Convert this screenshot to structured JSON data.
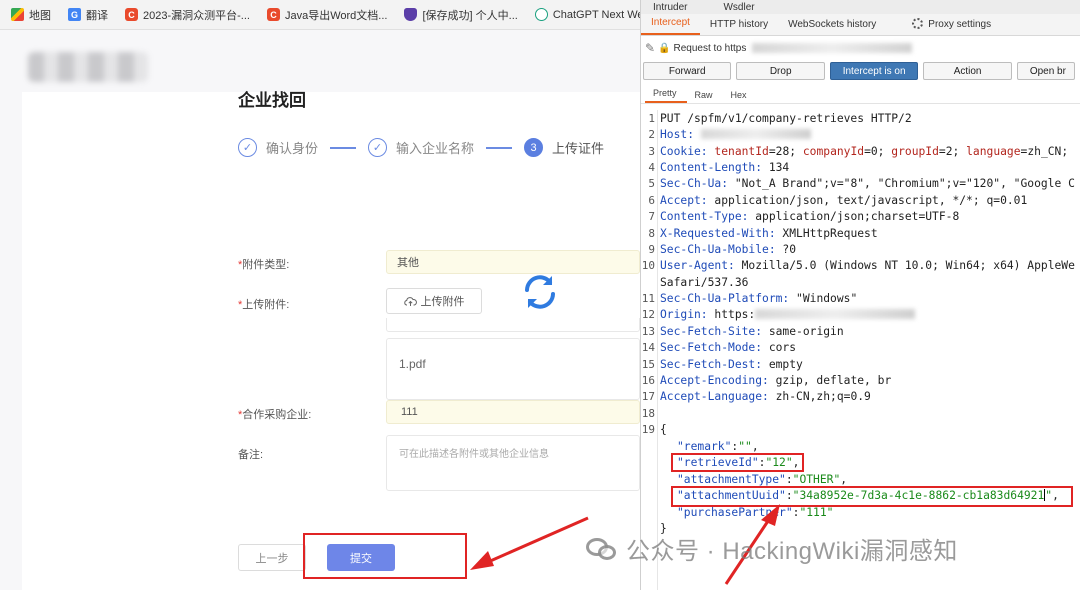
{
  "bookmarks": [
    {
      "label": "地图",
      "icon": "map-icon"
    },
    {
      "label": "翻译",
      "icon": "translate-icon"
    },
    {
      "label": "2023-漏洞众测平台-...",
      "icon": "csdn-icon"
    },
    {
      "label": "Java导出Word文档...",
      "icon": "csdn-icon"
    },
    {
      "label": "[保存成功] 个人中...",
      "icon": "shield-icon"
    },
    {
      "label": "ChatGPT Next Web",
      "icon": "chatgpt-icon"
    }
  ],
  "app": {
    "title": "企业找回",
    "steps": [
      {
        "label": "确认身份",
        "state": "done"
      },
      {
        "label": "输入企业名称",
        "state": "done"
      },
      {
        "number": "3",
        "label": "上传证件",
        "state": "active"
      }
    ],
    "form": {
      "attachment_type": {
        "label": "附件类型:",
        "value": "其他"
      },
      "upload": {
        "label": "上传附件:",
        "button": "上传附件",
        "file": "1.pdf"
      },
      "partner": {
        "label": "合作采购企业:",
        "value": "111"
      },
      "remark": {
        "label": "备注:",
        "placeholder": "可在此描述各附件或其他企业信息"
      }
    },
    "buttons": {
      "prev": "上一步",
      "submit": "提交"
    }
  },
  "burp": {
    "top_tabs": [
      "Intruder",
      "Wsdler"
    ],
    "tabs": [
      "Intercept",
      "HTTP history",
      "WebSockets history",
      "Proxy settings"
    ],
    "request_label": "Request to https",
    "buttons": [
      "Forward",
      "Drop",
      "Intercept is on",
      "Action",
      "Open br"
    ],
    "sub_tabs": [
      "Pretty",
      "Raw",
      "Hex"
    ],
    "lines": {
      "l1": "PUT /spfm/v1/company-retrieves HTTP/2",
      "host_k": "Host:",
      "cookie_k": "Cookie:",
      "cookie_parts": {
        "k1": "tenantId",
        "v1": "=28; ",
        "k2": "companyId",
        "v2": "=0; ",
        "k3": "groupId",
        "v3": "=2; ",
        "k4": "language",
        "v4": "=zh_CN;"
      },
      "h4": {
        "k": "Content-Length:",
        "v": " 134"
      },
      "h5": {
        "k": "Sec-Ch-Ua:",
        "v": " \"Not_A Brand\";v=\"8\", \"Chromium\";v=\"120\", \"Google C"
      },
      "h6": {
        "k": "Accept:",
        "v": " application/json, text/javascript, */*; q=0.01"
      },
      "h7": {
        "k": "Content-Type:",
        "v": " application/json;charset=UTF-8"
      },
      "h8": {
        "k": "X-Requested-With:",
        "v": " XMLHttpRequest"
      },
      "h9": {
        "k": "Sec-Ch-Ua-Mobile:",
        "v": " ?0"
      },
      "h10": {
        "k": "User-Agent:",
        "v": " Mozilla/5.0 (Windows NT 10.0; Win64; x64) AppleWe"
      },
      "h10b": "Safari/537.36",
      "h11": {
        "k": "Sec-Ch-Ua-Platform:",
        "v": " \"Windows\""
      },
      "h12": {
        "k": "Origin:",
        "v": " https:"
      },
      "h13": {
        "k": "Sec-Fetch-Site:",
        "v": " same-origin"
      },
      "h14": {
        "k": "Sec-Fetch-Mode:",
        "v": " cors"
      },
      "h15": {
        "k": "Sec-Fetch-Dest:",
        "v": " empty"
      },
      "h16": {
        "k": "Accept-Encoding:",
        "v": " gzip, deflate, br"
      },
      "h17": {
        "k": "Accept-Language:",
        "v": " zh-CN,zh;q=0.9"
      },
      "open": "{",
      "close": "}",
      "json": {
        "remark_k": "\"remark\"",
        "remark_v": "\"\"",
        "retrieve_k": "\"retrieveId\"",
        "retrieve_v": "\"12\"",
        "type_k": "\"attachmentType\"",
        "type_v": "\"OTHER\"",
        "uuid_k": "\"attachmentUuid\"",
        "uuid_v": "\"34a8952e-7d3a-4c1e-8862-cb1a83d64921",
        "partner_k": "\"purchasePartner\"",
        "partner_v": "\"111\""
      }
    }
  },
  "watermark": "公众号 · HackingWiki漏洞感知",
  "colors": {
    "annotation_red": "#e02424",
    "burp_orange": "#e8601c",
    "primary_blue": "#6e86e8"
  }
}
